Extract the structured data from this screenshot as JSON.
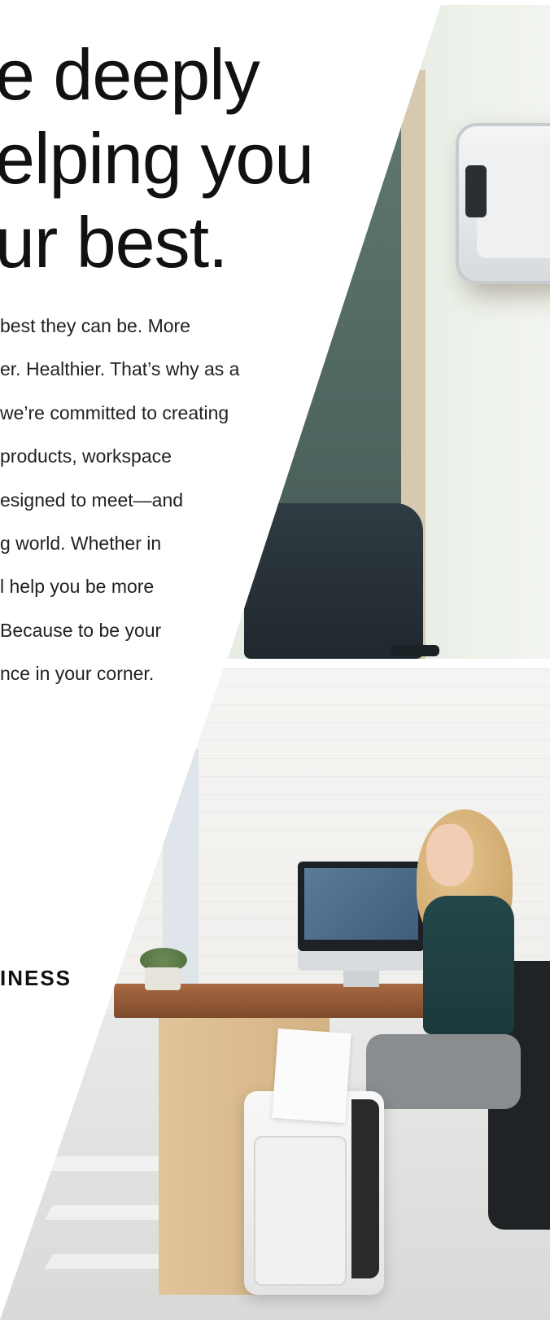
{
  "headline": {
    "lines": [
      "e deeply",
      "elping you",
      "ur best."
    ]
  },
  "body": {
    "lines": [
      "best they can be. More",
      "er. Healthier. That’s why as a",
      "we’re committed to creating",
      "products, workspace",
      "esigned to meet—and",
      "g world. Whether in",
      "l help you be more",
      "Because to be your",
      "nce in your corner."
    ]
  },
  "brand_text": "INESS",
  "photos": {
    "top": {
      "icon": "air-purifier-photo"
    },
    "bottom": {
      "icon": "office-shredder-photo"
    }
  }
}
